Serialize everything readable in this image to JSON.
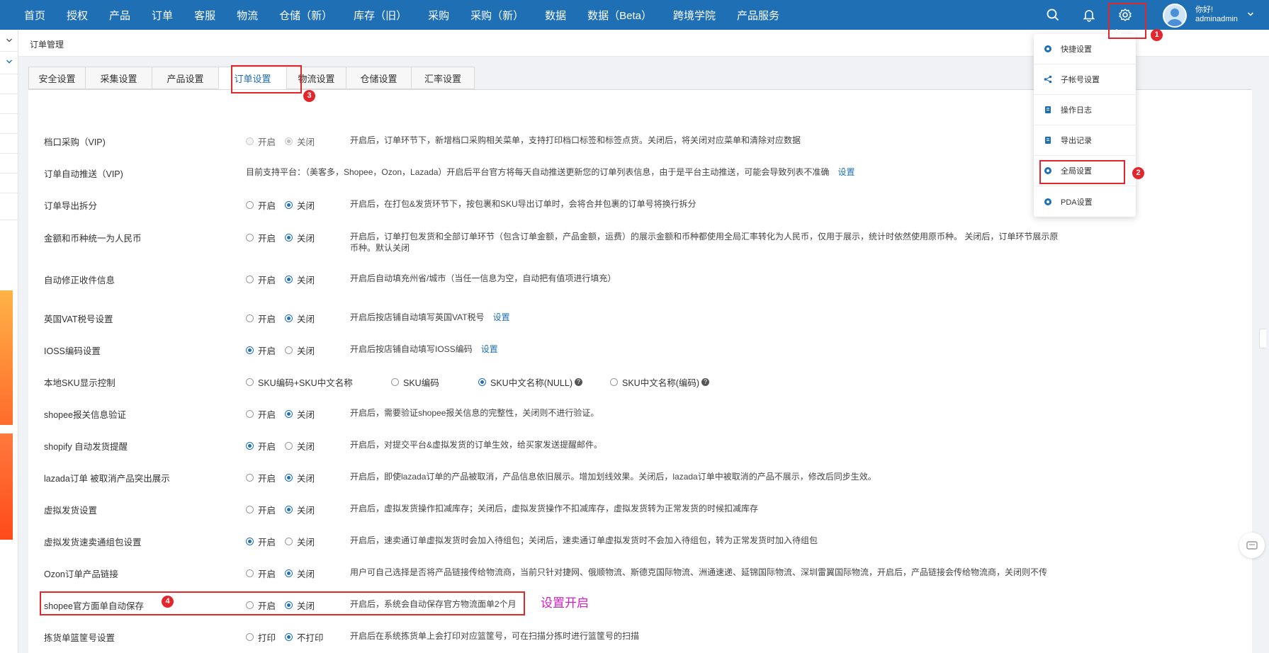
{
  "nav": {
    "items": [
      "首页",
      "授权",
      "产品",
      "订单",
      "客服",
      "物流",
      "仓储（新）",
      "库存（旧）",
      "采购",
      "采购（新）",
      "数据",
      "数据（Beta）",
      "跨境学院",
      "产品服务"
    ],
    "greeting": "你好!",
    "username": "adminadmin",
    "icons": [
      "search-icon",
      "bell-icon",
      "gear-icon"
    ]
  },
  "breadcrumb": "订单管理",
  "tabs": [
    {
      "label": "安全设置",
      "active": false
    },
    {
      "label": "采集设置",
      "active": false
    },
    {
      "label": "产品设置",
      "active": false
    },
    {
      "label": "订单设置",
      "active": true
    },
    {
      "label": "物流设置",
      "active": false
    },
    {
      "label": "仓储设置",
      "active": false
    },
    {
      "label": "汇率设置",
      "active": false
    }
  ],
  "dropdown": {
    "items": [
      {
        "label": "快捷设置",
        "icon": "gear-icon"
      },
      {
        "label": "子帐号设置",
        "icon": "share-icon"
      },
      {
        "label": "操作日志",
        "icon": "doc-icon"
      },
      {
        "label": "导出记录",
        "icon": "doc-icon"
      },
      {
        "label": "全局设置",
        "icon": "gear-icon"
      },
      {
        "label": "PDA设置",
        "icon": "gear-icon"
      }
    ]
  },
  "settings": [
    {
      "label": "档口采购（VIP)",
      "on": "开启",
      "off": "关闭",
      "selected": "off",
      "disabled": true,
      "desc": "开启后，订单环节下，新增档口采购相关菜单，支持打印档口标签和标签点货。关闭后，将关闭对应菜单和清除对应数据"
    },
    {
      "label": "订单自动推送（VIP)",
      "text": "目前支持平台：（美客多，Shopee，Ozon，Lazada）开启后平台官方将每天自动推送更新您的订单列表信息，由于是平台主动推送，可能会导致列表不准确",
      "link": "设置"
    },
    {
      "label": "订单导出拆分",
      "on": "开启",
      "off": "关闭",
      "selected": "off",
      "desc": "开启后，在打包&发货环节下，按包裹和SKU导出订单时，会将合并包裹的订单号将换行拆分"
    },
    {
      "label": "金额和币种统一为人民币",
      "on": "开启",
      "off": "关闭",
      "selected": "off",
      "desc": "开启后，订单打包发货和全部订单环节（包含订单金额，产品金额，运费）的展示金额和币种都使用全局汇率转化为人民币，仅用于展示，统计时依然使用原币种。 关闭后，订单环节展示原",
      "desc2": "币种。默认关闭"
    },
    {
      "label": "自动修正收件信息",
      "on": "开启",
      "off": "关闭",
      "selected": "off",
      "desc": "开启后自动填充州省/城市（当任一信息为空，自动把有值项进行填充）"
    },
    {
      "label": "英国VAT税号设置",
      "on": "开启",
      "off": "关闭",
      "selected": "off",
      "desc": "开启后按店铺自动填写英国VAT税号",
      "link": "设置"
    },
    {
      "label": "IOSS编码设置",
      "on": "开启",
      "off": "关闭",
      "selected": "on",
      "desc": "开启后按店铺自动填写IOSS编码",
      "link": "设置"
    },
    {
      "label": "本地SKU显示控制",
      "options": [
        "SKU编码+SKU中文名称",
        "SKU编码",
        "SKU中文名称(NULL)",
        "SKU中文名称(编码)"
      ],
      "selected_index": 2
    },
    {
      "label": "shopee报关信息验证",
      "on": "开启",
      "off": "关闭",
      "selected": "off",
      "desc": "开启后，需要验证shopee报关信息的完整性，关闭则不进行验证。"
    },
    {
      "label": "shopify 自动发货提醒",
      "on": "开启",
      "off": "关闭",
      "selected": "on",
      "desc": "开启后，对提交平台&虚拟发货的订单生效，给买家发送提醒邮件。"
    },
    {
      "label": "lazada订单 被取消产品突出展示",
      "on": "开启",
      "off": "关闭",
      "selected": "off",
      "desc": "开启后，即使lazada订单的产品被取消，产品信息依旧展示。增加划线效果。关闭后，lazada订单中被取消的产品不展示，修改后同步生效。"
    },
    {
      "label": "虚拟发货设置",
      "on": "开启",
      "off": "关闭",
      "selected": "off",
      "desc": "开启后，虚拟发货操作扣减库存；关闭后，虚拟发货操作不扣减库存，虚拟发货转为正常发货的时候扣减库存"
    },
    {
      "label": "虚拟发货速卖通组包设置",
      "on": "开启",
      "off": "关闭",
      "selected": "on",
      "desc": "开启后，速卖通订单虚拟发货时会加入待组包；关闭后，速卖通订单虚拟发货时不会加入待组包，转为正常发货时加入待组包"
    },
    {
      "label": "Ozon订单产品链接",
      "on": "开启",
      "off": "关闭",
      "selected": "off",
      "desc": "用户可自己选择是否将产品链接传给物流商，当前只针对捷网、俄顺物流、斯德克国际物流、洲通速递、延锦国际物流、深圳雷翼国际物流，开启后，产品链接会传给物流商，关闭则不传"
    },
    {
      "label": "shopee官方面单自动保存",
      "on": "开启",
      "off": "关闭",
      "selected": "off",
      "desc": "开启后，系统会自动保存官方物流面单2个月"
    },
    {
      "label": "拣货单篮筐号设置",
      "on": "打印",
      "off": "不打印",
      "selected": "off",
      "desc": "开启后在系统拣货单上会打印对应篮筐号，可在扫描分拣时进行篮筐号的扫描"
    }
  ],
  "annotations": {
    "badges": [
      "1",
      "2",
      "3",
      "4"
    ],
    "note": "设置开启"
  },
  "colors": {
    "primary": "#1f6fb5",
    "annotation": "#e3262c",
    "note": "#d020c0"
  }
}
